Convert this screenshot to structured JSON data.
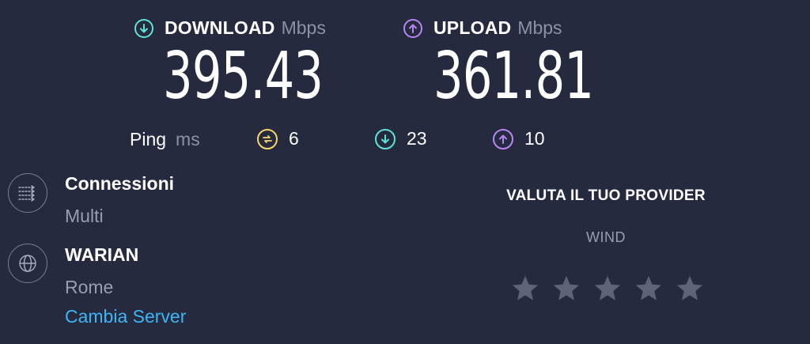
{
  "download": {
    "label": "DOWNLOAD",
    "unit": "Mbps",
    "value": "395.43",
    "color": "#5ee3d6"
  },
  "upload": {
    "label": "UPLOAD",
    "unit": "Mbps",
    "value": "361.81",
    "color": "#b985f5"
  },
  "ping": {
    "label": "Ping",
    "unit": "ms",
    "idle": "6",
    "download": "23",
    "upload": "10",
    "idle_color": "#f5d76e"
  },
  "connections": {
    "title": "Connessioni",
    "value": "Multi"
  },
  "server": {
    "name": "WARIAN",
    "location": "Rome",
    "change_label": "Cambia Server"
  },
  "rating": {
    "title": "VALUTA IL TUO PROVIDER",
    "provider": "WIND",
    "stars_max": 5,
    "stars_selected": 0
  },
  "colors": {
    "background": "#262a3e",
    "link": "#3db5f5",
    "star_empty": "#5f6378"
  }
}
